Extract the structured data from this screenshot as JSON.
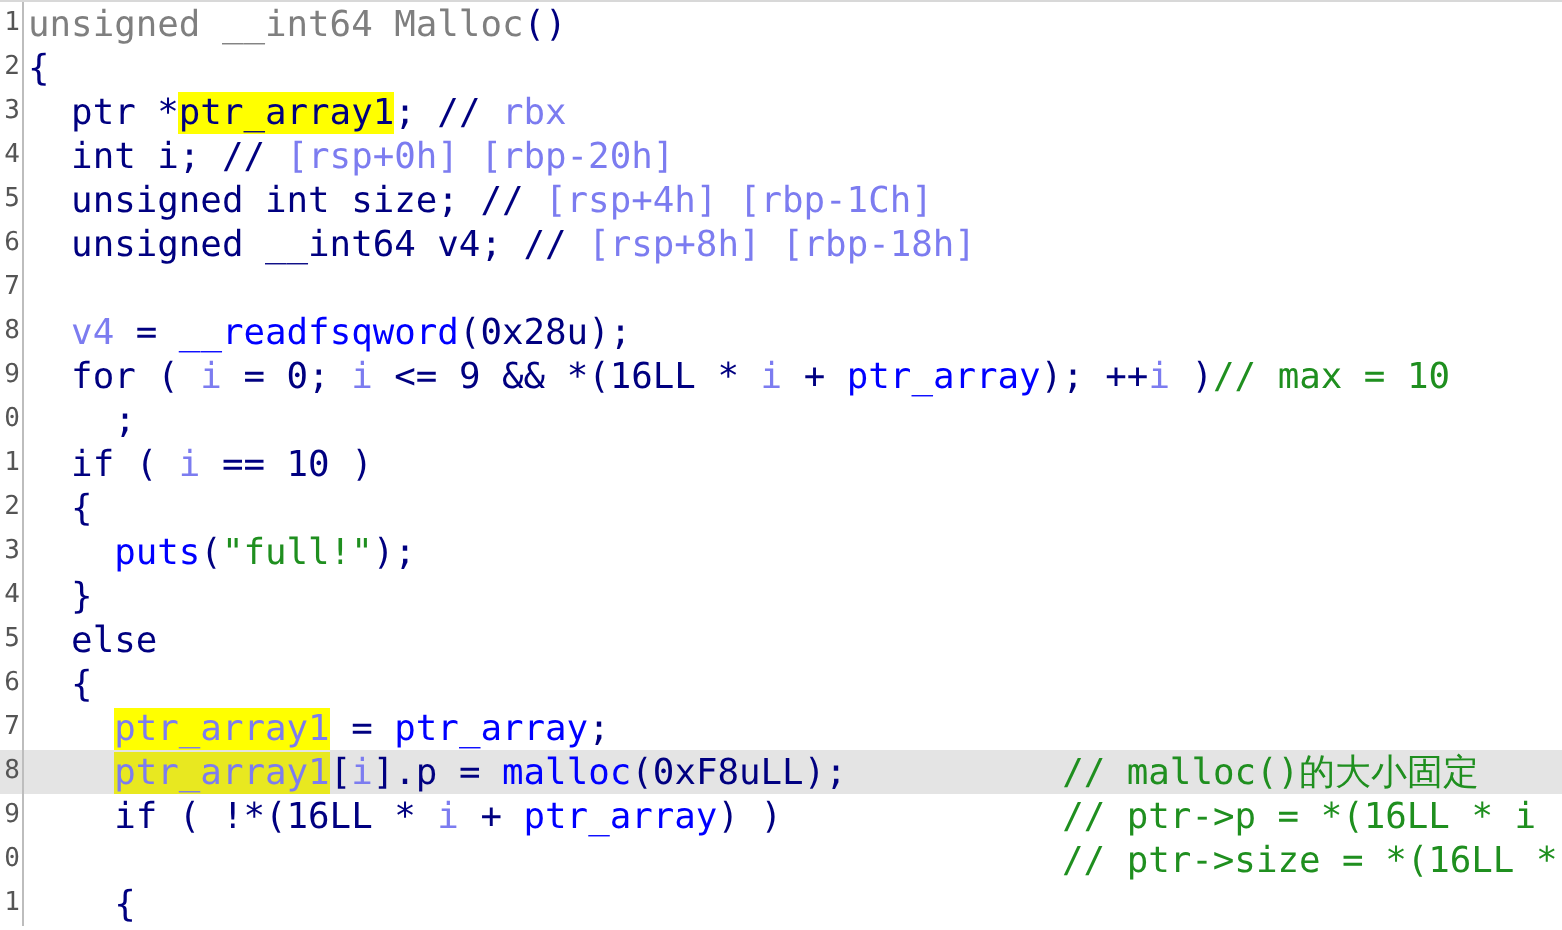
{
  "lines": [
    {
      "number": "1",
      "current": false,
      "tokens": [
        {
          "kind": "header",
          "text": "unsigned __int64 Malloc"
        },
        {
          "kind": "plain",
          "text": "()"
        }
      ]
    },
    {
      "number": "2",
      "current": false,
      "tokens": [
        {
          "kind": "plain",
          "text": "{"
        }
      ]
    },
    {
      "number": "3",
      "current": false,
      "tokens": [
        {
          "kind": "plain",
          "text": "  ptr *"
        },
        {
          "kind": "plain",
          "text": "ptr_array1",
          "highlighted": true
        },
        {
          "kind": "plain",
          "text": "; // "
        },
        {
          "kind": "var",
          "text": "rbx"
        }
      ]
    },
    {
      "number": "4",
      "current": false,
      "tokens": [
        {
          "kind": "plain",
          "text": "  int i; // "
        },
        {
          "kind": "var",
          "text": "[rsp+0h] [rbp-20h]"
        }
      ]
    },
    {
      "number": "5",
      "current": false,
      "tokens": [
        {
          "kind": "plain",
          "text": "  unsigned int size; // "
        },
        {
          "kind": "var",
          "text": "[rsp+4h] [rbp-1Ch]"
        }
      ]
    },
    {
      "number": "6",
      "current": false,
      "tokens": [
        {
          "kind": "plain",
          "text": "  unsigned __int64 v4; // "
        },
        {
          "kind": "var",
          "text": "[rsp+8h] [rbp-18h]"
        }
      ]
    },
    {
      "number": "7",
      "current": false
    },
    {
      "number": "8",
      "current": false,
      "tokens": [
        {
          "kind": "var",
          "text": "  v4"
        },
        {
          "kind": "plain",
          "text": " = "
        },
        {
          "kind": "name",
          "text": "__readfsqword"
        },
        {
          "kind": "plain",
          "text": "(0x28u);"
        }
      ]
    },
    {
      "number": "9",
      "current": false,
      "tokens": [
        {
          "kind": "plain",
          "text": "  for ( "
        },
        {
          "kind": "var",
          "text": "i"
        },
        {
          "kind": "plain",
          "text": " = 0; "
        },
        {
          "kind": "var",
          "text": "i"
        },
        {
          "kind": "plain",
          "text": " <= 9 && *(16LL * "
        },
        {
          "kind": "var",
          "text": "i"
        },
        {
          "kind": "plain",
          "text": " + "
        },
        {
          "kind": "name",
          "text": "ptr_array"
        },
        {
          "kind": "plain",
          "text": "); ++"
        },
        {
          "kind": "var",
          "text": "i"
        },
        {
          "kind": "plain",
          "text": " )"
        },
        {
          "kind": "comment",
          "text": "// max = 10"
        }
      ]
    },
    {
      "number": "0",
      "current": false,
      "tokens": [
        {
          "kind": "plain",
          "text": "    ;"
        }
      ]
    },
    {
      "number": "1",
      "current": false,
      "tokens": [
        {
          "kind": "plain",
          "text": "  if ( "
        },
        {
          "kind": "var",
          "text": "i"
        },
        {
          "kind": "plain",
          "text": " == 10 )"
        }
      ]
    },
    {
      "number": "2",
      "current": false,
      "tokens": [
        {
          "kind": "plain",
          "text": "  {"
        }
      ]
    },
    {
      "number": "3",
      "current": false,
      "tokens": [
        {
          "kind": "name",
          "text": "    puts"
        },
        {
          "kind": "plain",
          "text": "("
        },
        {
          "kind": "comment",
          "text": "\"full!\""
        },
        {
          "kind": "plain",
          "text": ");"
        }
      ]
    },
    {
      "number": "4",
      "current": false,
      "tokens": [
        {
          "kind": "plain",
          "text": "  }"
        }
      ]
    },
    {
      "number": "5",
      "current": false,
      "tokens": [
        {
          "kind": "plain",
          "text": "  else"
        }
      ]
    },
    {
      "number": "6",
      "current": false,
      "tokens": [
        {
          "kind": "plain",
          "text": "  {"
        }
      ]
    },
    {
      "number": "7",
      "current": false,
      "tokens": [
        {
          "kind": "var",
          "text": "    ptr_array1",
          "highlighted": true
        },
        {
          "kind": "plain",
          "text": " = "
        },
        {
          "kind": "name",
          "text": "ptr_array"
        },
        {
          "kind": "plain",
          "text": ";"
        }
      ]
    },
    {
      "number": "8",
      "current": true,
      "tokens": [
        {
          "kind": "var",
          "text": "    ptr_array1",
          "highlighted": true
        },
        {
          "kind": "plain",
          "text": "["
        },
        {
          "kind": "var",
          "text": "i"
        },
        {
          "kind": "plain",
          "text": "].p = "
        },
        {
          "kind": "name",
          "text": "malloc"
        },
        {
          "kind": "plain",
          "text": "(0xF8uLL);          "
        },
        {
          "kind": "comment",
          "text": "// malloc()的大小固定"
        }
      ]
    },
    {
      "number": "9",
      "current": false,
      "tokens": [
        {
          "kind": "plain",
          "text": "    if ( !*(16LL * "
        },
        {
          "kind": "var",
          "text": "i"
        },
        {
          "kind": "plain",
          "text": " + "
        },
        {
          "kind": "name",
          "text": "ptr_array"
        },
        {
          "kind": "plain",
          "text": ") )             "
        },
        {
          "kind": "comment",
          "text": "// ptr->p = *(16LL * i"
        }
      ]
    },
    {
      "number": "0",
      "current": false,
      "tokens": [
        {
          "kind": "comment",
          "text": "                                                // ptr->size = *(16LL *"
        }
      ]
    },
    {
      "number": "1",
      "current": false,
      "tokens": [
        {
          "kind": "plain",
          "text": "    {"
        }
      ]
    }
  ]
}
